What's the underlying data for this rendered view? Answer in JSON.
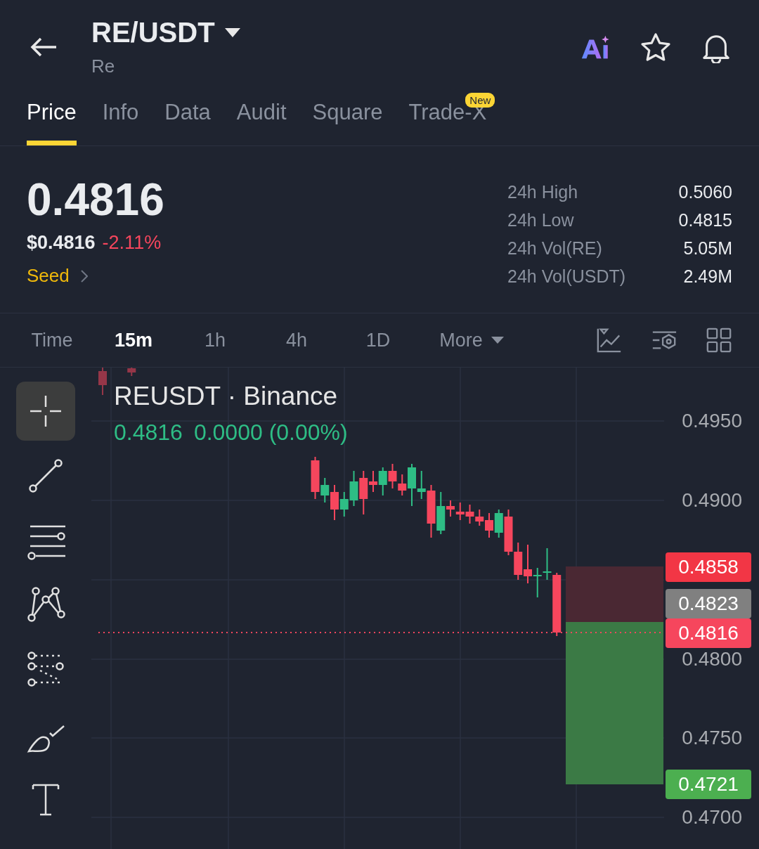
{
  "header": {
    "title": "RE/USDT",
    "subtitle": "Re"
  },
  "tabs": [
    {
      "label": "Price",
      "selected": true
    },
    {
      "label": "Info",
      "selected": false
    },
    {
      "label": "Data",
      "selected": false
    },
    {
      "label": "Audit",
      "selected": false
    },
    {
      "label": "Square",
      "selected": false
    },
    {
      "label": "Trade-X",
      "selected": false,
      "badge": "New"
    }
  ],
  "price": {
    "last": "0.4816",
    "fiat": "$0.4816",
    "change": "-2.11%",
    "tag": "Seed"
  },
  "stats": [
    {
      "label": "24h High",
      "value": "0.5060"
    },
    {
      "label": "24h Low",
      "value": "0.4815"
    },
    {
      "label": "24h Vol(RE)",
      "value": "5.05M"
    },
    {
      "label": "24h Vol(USDT)",
      "value": "2.49M"
    }
  ],
  "intervals": [
    {
      "label": "Time",
      "kind": "plain",
      "selected": false
    },
    {
      "label": "15m",
      "kind": "plain",
      "selected": true
    },
    {
      "label": "1h",
      "kind": "plain",
      "selected": false
    },
    {
      "label": "4h",
      "kind": "plain",
      "selected": false
    },
    {
      "label": "1D",
      "kind": "plain",
      "selected": false
    },
    {
      "label": "More",
      "kind": "dropdown",
      "selected": false
    }
  ],
  "tools": [
    {
      "kind": "crosshair",
      "selected": true
    },
    {
      "kind": "trend-line",
      "selected": false
    },
    {
      "kind": "parallel-lines",
      "selected": false
    },
    {
      "kind": "pattern",
      "selected": false
    },
    {
      "kind": "fib",
      "selected": false
    },
    {
      "kind": "brush",
      "selected": false
    },
    {
      "kind": "text",
      "selected": false
    }
  ],
  "chart": {
    "legend": "REUSDT · Binance",
    "legend_price": "0.4816",
    "legend_change": "0.0000 (0.00%)",
    "y_axis": [
      "0.4950",
      "0.4900",
      "0.4800",
      "0.4750",
      "0.4700"
    ],
    "price_badges": [
      {
        "value": "0.4858",
        "color": "#f23645"
      },
      {
        "value": "0.4823",
        "color": "#808080"
      },
      {
        "value": "0.4816",
        "color": "#f6465d"
      },
      {
        "value": "0.4721",
        "color": "#4caf50"
      }
    ]
  }
}
